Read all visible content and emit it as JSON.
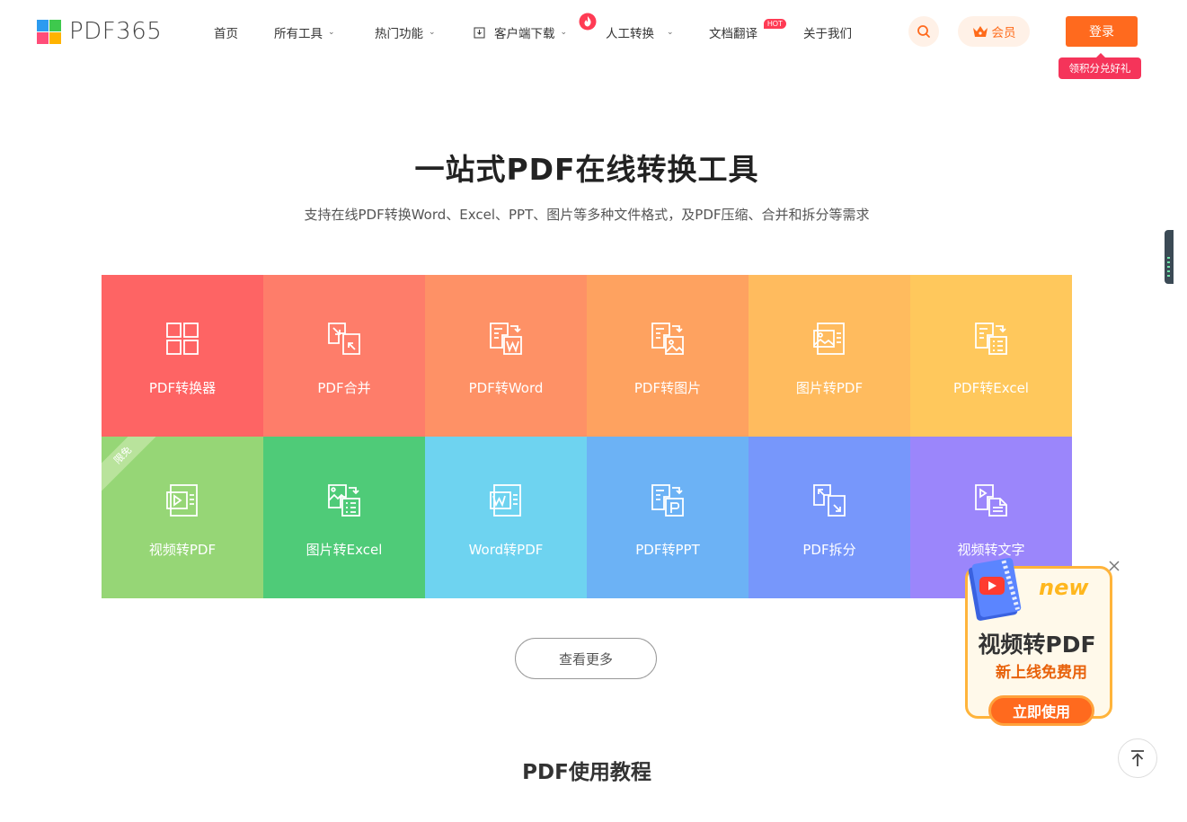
{
  "header": {
    "logo_text": "PDF365",
    "logo_colors": [
      "#2c9bf0",
      "#3ec94d",
      "#ff4d79",
      "#ffb300"
    ],
    "nav": [
      {
        "label": "首页"
      },
      {
        "label": "所有工具",
        "dropdown": true
      },
      {
        "label": "热门功能",
        "dropdown": true
      },
      {
        "label": "客户端下载",
        "dropdown": true
      },
      {
        "label": "人工转换",
        "dropdown": true
      },
      {
        "label": "文档翻译"
      },
      {
        "label": "关于我们"
      }
    ],
    "hot_badge": "HOT",
    "vip_label": "会员",
    "login_label": "登录",
    "reward_label": "领积分兑好礼",
    "accent_color": "#ff6a1e"
  },
  "hero": {
    "title": "一站式PDF在线转换工具",
    "subtitle": "支持在线PDF转换Word、Excel、PPT、图片等多种文件格式，及PDF压缩、合并和拆分等需求"
  },
  "tools": [
    {
      "label": "PDF转换器",
      "icon": "grid-icon",
      "color": "#fe6464"
    },
    {
      "label": "PDF合并",
      "icon": "merge-icon",
      "color": "#fe7d6a"
    },
    {
      "label": "PDF转Word",
      "icon": "pdf-to-word-icon",
      "color": "#fe9166"
    },
    {
      "label": "PDF转图片",
      "icon": "pdf-to-image-icon",
      "color": "#fea260"
    },
    {
      "label": "图片转PDF",
      "icon": "image-to-pdf-icon",
      "color": "#ffbb5e"
    },
    {
      "label": "PDF转Excel",
      "icon": "pdf-to-excel-icon",
      "color": "#ffc85c"
    },
    {
      "label": "视频转PDF",
      "icon": "video-to-pdf-icon",
      "color": "#96d676",
      "ribbon": "限免"
    },
    {
      "label": "图片转Excel",
      "icon": "image-to-excel-icon",
      "color": "#4fcb78"
    },
    {
      "label": "Word转PDF",
      "icon": "word-to-pdf-icon",
      "color": "#6ed3f0"
    },
    {
      "label": "PDF转PPT",
      "icon": "pdf-to-ppt-icon",
      "color": "#6cb2f5"
    },
    {
      "label": "PDF拆分",
      "icon": "split-icon",
      "color": "#7797fb"
    },
    {
      "label": "视频转文字",
      "icon": "video-to-text-icon",
      "color": "#9b86fb"
    }
  ],
  "more_button": "查看更多",
  "section_title": "PDF使用教程",
  "promo": {
    "new_label": "new",
    "title": "视频转PDF",
    "subtitle": "新上线免费用",
    "button": "立即使用"
  }
}
